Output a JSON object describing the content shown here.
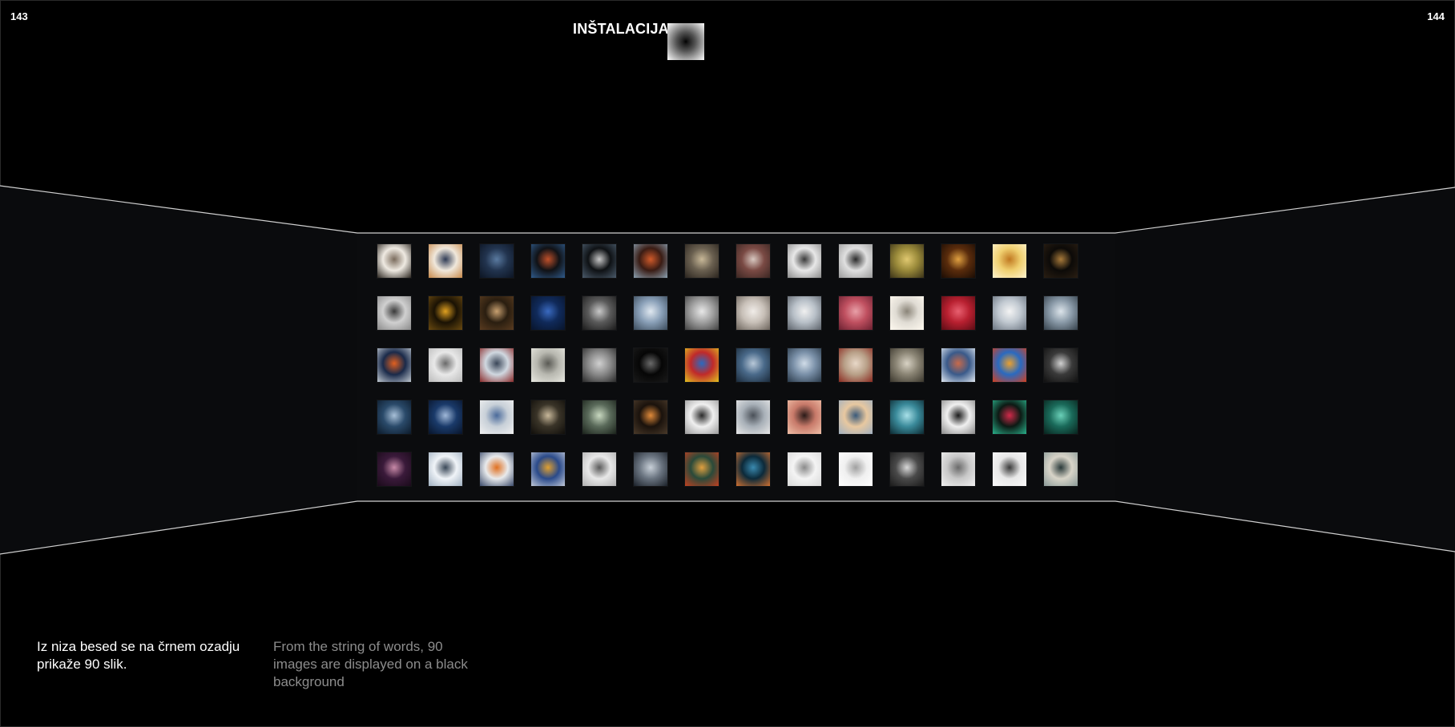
{
  "page_numbers": {
    "left": "143",
    "right": "144"
  },
  "section_title": "INŠTALACIJA",
  "caption": {
    "slovenian": "Iz niza besed se na črnem ozadju prikaže 90 slik.",
    "english": "From the string of words, 90 images are displayed on a black background"
  },
  "colors": {
    "background": "#000000",
    "wall": "#0a0b0d",
    "edge_lines": "#cfcfcf",
    "caption_primary": "#ffffff",
    "caption_secondary": "#8c8c8c"
  },
  "gallery": {
    "rows": [
      [
        {
          "name": "thumb-r1-c1",
          "colors": [
            "#efeae2",
            "#7a6b5c",
            "#2b2620"
          ]
        },
        {
          "name": "thumb-r1-c2",
          "colors": [
            "#f0e8dc",
            "#2f3b55",
            "#c7894a"
          ]
        },
        {
          "name": "thumb-r1-c3",
          "colors": [
            "#22344f",
            "#5a7aa0",
            "#0c1422"
          ]
        },
        {
          "name": "thumb-r1-c4",
          "colors": [
            "#101216",
            "#c0502a",
            "#2f5a8a"
          ]
        },
        {
          "name": "thumb-r1-c5",
          "colors": [
            "#0e1114",
            "#c8c8c8",
            "#4a5a6a"
          ]
        },
        {
          "name": "thumb-r1-c6",
          "colors": [
            "#3a1c14",
            "#d05a2a",
            "#8aa0b0"
          ]
        },
        {
          "name": "thumb-r1-c7",
          "colors": [
            "#6a6050",
            "#c8b898",
            "#2a241e"
          ]
        },
        {
          "name": "thumb-r1-c8",
          "colors": [
            "#7a4a44",
            "#d8c8c0",
            "#3a2622"
          ]
        },
        {
          "name": "thumb-r1-c9",
          "colors": [
            "#e8e8e8",
            "#3a3a3a",
            "#8a8a8a"
          ]
        },
        {
          "name": "thumb-r1-c10",
          "colors": [
            "#e0e0e0",
            "#2a2a2a",
            "#9a9a9a"
          ]
        },
        {
          "name": "thumb-r1-c11",
          "colors": [
            "#9a8a3a",
            "#e0c870",
            "#3a3218"
          ]
        },
        {
          "name": "thumb-r1-c12",
          "colors": [
            "#5a2c0c",
            "#e0a040",
            "#1a0c04"
          ]
        },
        {
          "name": "thumb-r1-c13",
          "colors": [
            "#f0d070",
            "#c07820",
            "#fff4d0"
          ]
        },
        {
          "name": "thumb-r1-c14",
          "colors": [
            "#0c0a08",
            "#a87a3a",
            "#2a1e12"
          ]
        }
      ],
      [
        {
          "name": "thumb-r2-c1",
          "colors": [
            "#d0d0d0",
            "#3a3a3a",
            "#8a8a8a"
          ]
        },
        {
          "name": "thumb-r2-c2",
          "colors": [
            "#1a1204",
            "#e0a020",
            "#6a4a10"
          ]
        },
        {
          "name": "thumb-r2-c3",
          "colors": [
            "#2a1e10",
            "#c8a070",
            "#5a3c20"
          ]
        },
        {
          "name": "thumb-r2-c4",
          "colors": [
            "#102a5a",
            "#3a6ac0",
            "#08142a"
          ]
        },
        {
          "name": "thumb-r2-c5",
          "colors": [
            "#5a5a5a",
            "#c8c8c8",
            "#1a1a1a"
          ]
        },
        {
          "name": "thumb-r2-c6",
          "colors": [
            "#8aa0b8",
            "#e0e8f0",
            "#3a4a5a"
          ]
        },
        {
          "name": "thumb-r2-c7",
          "colors": [
            "#a0a0a0",
            "#e8e8e8",
            "#404040"
          ]
        },
        {
          "name": "thumb-r2-c8",
          "colors": [
            "#c8c0b8",
            "#f0ece8",
            "#6a625a"
          ]
        },
        {
          "name": "thumb-r2-c9",
          "colors": [
            "#b8c0c8",
            "#f0f0f0",
            "#5a6068"
          ]
        },
        {
          "name": "thumb-r2-c10",
          "colors": [
            "#c05060",
            "#e8a0a8",
            "#6a2030"
          ]
        },
        {
          "name": "thumb-r2-c11",
          "colors": [
            "#e0dcd4",
            "#8a8478",
            "#fffaf0"
          ]
        },
        {
          "name": "thumb-r2-c12",
          "colors": [
            "#b82030",
            "#e86070",
            "#5a0c14"
          ]
        },
        {
          "name": "thumb-r2-c13",
          "colors": [
            "#c0c8d0",
            "#f4f4f4",
            "#6a7480"
          ]
        },
        {
          "name": "thumb-r2-c14",
          "colors": [
            "#8a9aa8",
            "#dce4ea",
            "#34404a"
          ]
        }
      ],
      [
        {
          "name": "thumb-r3-c1",
          "colors": [
            "#1a2a4a",
            "#e06020",
            "#c0c8d0"
          ]
        },
        {
          "name": "thumb-r3-c2",
          "colors": [
            "#e8e8e8",
            "#6a6a6a",
            "#bababa"
          ]
        },
        {
          "name": "thumb-r3-c3",
          "colors": [
            "#d0d8e0",
            "#3a4658",
            "#8a2a2a"
          ]
        },
        {
          "name": "thumb-r3-c4",
          "colors": [
            "#b8b8b0",
            "#5a5a54",
            "#e8e8e0"
          ]
        },
        {
          "name": "thumb-r3-c5",
          "colors": [
            "#8a8a8a",
            "#d0d0d0",
            "#2a2a2a"
          ]
        },
        {
          "name": "thumb-r3-c6",
          "colors": [
            "#060606",
            "#6a6a6a",
            "#1a1a1a"
          ]
        },
        {
          "name": "thumb-r3-c7",
          "colors": [
            "#c02a2a",
            "#2a6ac0",
            "#e0c020"
          ]
        },
        {
          "name": "thumb-r3-c8",
          "colors": [
            "#4a6a8a",
            "#b8c8d8",
            "#1a2a3a"
          ]
        },
        {
          "name": "thumb-r3-c9",
          "colors": [
            "#7a90a8",
            "#d0dce8",
            "#2a3a4a"
          ]
        },
        {
          "name": "thumb-r3-c10",
          "colors": [
            "#b8a088",
            "#e8d8c8",
            "#8a2a20"
          ]
        },
        {
          "name": "thumb-r3-c11",
          "colors": [
            "#8a8474",
            "#d8d2c4",
            "#3a362c"
          ]
        },
        {
          "name": "thumb-r3-c12",
          "colors": [
            "#3a5a8a",
            "#c86a4a",
            "#e0e8f0"
          ]
        },
        {
          "name": "thumb-r3-c13",
          "colors": [
            "#2a6ac0",
            "#e8a030",
            "#d04020"
          ]
        },
        {
          "name": "thumb-r3-c14",
          "colors": [
            "#3a3a3a",
            "#d0d0d0",
            "#101010"
          ]
        }
      ],
      [
        {
          "name": "thumb-r4-c1",
          "colors": [
            "#2a4a6a",
            "#a8c0d8",
            "#0c1a2a"
          ]
        },
        {
          "name": "thumb-r4-c2",
          "colors": [
            "#1a3a6a",
            "#a0b8d8",
            "#08142a"
          ]
        },
        {
          "name": "thumb-r4-c3",
          "colors": [
            "#c8d0d8",
            "#4a6a9a",
            "#f0f0f0"
          ]
        },
        {
          "name": "thumb-r4-c4",
          "colors": [
            "#3a3428",
            "#c8b89a",
            "#100e0a"
          ]
        },
        {
          "name": "thumb-r4-c5",
          "colors": [
            "#5a6a5a",
            "#c8d8c0",
            "#1a221a"
          ]
        },
        {
          "name": "thumb-r4-c6",
          "colors": [
            "#1a120c",
            "#e08a3a",
            "#4a3a2a"
          ]
        },
        {
          "name": "thumb-r4-c7",
          "colors": [
            "#f0f0f0",
            "#2a2a2a",
            "#9a9a9a"
          ]
        },
        {
          "name": "thumb-r4-c8",
          "colors": [
            "#a8b0b8",
            "#4a5058",
            "#e8e8e8"
          ]
        },
        {
          "name": "thumb-r4-c9",
          "colors": [
            "#c87a6a",
            "#2a1a18",
            "#f0c0a8"
          ]
        },
        {
          "name": "thumb-r4-c10",
          "colors": [
            "#e8c8a0",
            "#3a5a7a",
            "#a0b0c0"
          ]
        },
        {
          "name": "thumb-r4-c11",
          "colors": [
            "#3a8a9a",
            "#a8e0e8",
            "#0c2a32"
          ]
        },
        {
          "name": "thumb-r4-c12",
          "colors": [
            "#f0f0f0",
            "#1a1a1a",
            "#8a8a8a"
          ]
        },
        {
          "name": "thumb-r4-c13",
          "colors": [
            "#0c1a14",
            "#d02a4a",
            "#2ab08a"
          ]
        },
        {
          "name": "thumb-r4-c14",
          "colors": [
            "#1a6a5a",
            "#6ad0b8",
            "#08221c"
          ]
        }
      ],
      [
        {
          "name": "thumb-r5-c1",
          "colors": [
            "#3a1a3a",
            "#c88aa8",
            "#1a0a1a"
          ]
        },
        {
          "name": "thumb-r5-c2",
          "colors": [
            "#f0f4f8",
            "#3a4858",
            "#a0b0c0"
          ]
        },
        {
          "name": "thumb-r5-c3",
          "colors": [
            "#e8eaec",
            "#e07020",
            "#3a4a6a"
          ]
        },
        {
          "name": "thumb-r5-c4",
          "colors": [
            "#2a4a8a",
            "#e0a030",
            "#c0c8d8"
          ]
        },
        {
          "name": "thumb-r5-c5",
          "colors": [
            "#e8e8e8",
            "#5a5a5a",
            "#b0b0b0"
          ]
        },
        {
          "name": "thumb-r5-c6",
          "colors": [
            "#6a7480",
            "#c8d0d8",
            "#1a2028"
          ]
        },
        {
          "name": "thumb-r5-c7",
          "colors": [
            "#2a4a3a",
            "#e0a040",
            "#c04020"
          ]
        },
        {
          "name": "thumb-r5-c8",
          "colors": [
            "#0c2a3a",
            "#3a8ab0",
            "#d07030"
          ]
        },
        {
          "name": "thumb-r5-c9",
          "colors": [
            "#f4f4f4",
            "#8a8a8a",
            "#d8d8d8"
          ]
        },
        {
          "name": "thumb-r5-c10",
          "colors": [
            "#f0f0f0",
            "#a0a0a0",
            "#ffffff"
          ]
        },
        {
          "name": "thumb-r5-c11",
          "colors": [
            "#4a4a4a",
            "#d8d8d8",
            "#1a1a1a"
          ]
        },
        {
          "name": "thumb-r5-c12",
          "colors": [
            "#c8c8c8",
            "#6a6a6a",
            "#f0f0f0"
          ]
        },
        {
          "name": "thumb-r5-c13",
          "colors": [
            "#e8e8e8",
            "#3a3a3a",
            "#fafafa"
          ]
        },
        {
          "name": "thumb-r5-c14",
          "colors": [
            "#d8d4c8",
            "#2a3a3a",
            "#8a9a98"
          ]
        }
      ]
    ]
  }
}
